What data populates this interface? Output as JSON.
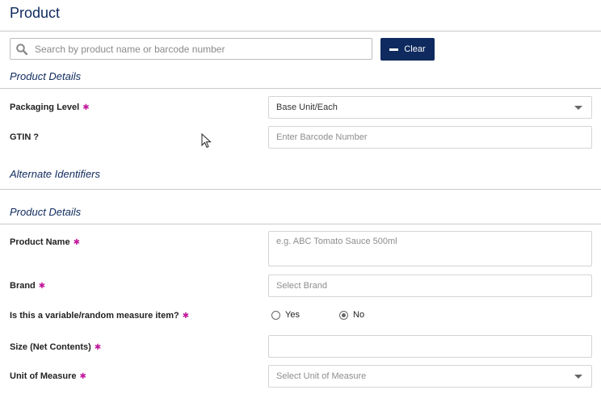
{
  "page": {
    "title": "Product"
  },
  "search": {
    "placeholder": "Search by product name or barcode number",
    "icon": "search-icon",
    "clear_label": "Clear",
    "clear_icon": "minus-icon"
  },
  "sections": {
    "product_details_1": "Product Details",
    "alternate_identifiers": "Alternate Identifiers",
    "product_details_2": "Product Details"
  },
  "fields": {
    "packaging_level": {
      "label": "Packaging Level",
      "value": "Base Unit/Each",
      "required": true
    },
    "gtin": {
      "label": "GTIN",
      "help": "?",
      "placeholder": "Enter Barcode Number"
    },
    "product_name": {
      "label": "Product Name",
      "placeholder": "e.g. ABC Tomato Sauce 500ml",
      "required": true
    },
    "brand": {
      "label": "Brand",
      "placeholder": "Select Brand",
      "required": true
    },
    "variable_measure": {
      "label": "Is this a variable/random measure item?",
      "required": true,
      "options": [
        {
          "label": "Yes",
          "selected": false
        },
        {
          "label": "No",
          "selected": true
        }
      ]
    },
    "size": {
      "label": "Size (Net Contents)",
      "value": "",
      "required": true
    },
    "unit_of_measure": {
      "label": "Unit of Measure",
      "placeholder": "Select Unit of Measure",
      "required": true
    }
  },
  "required_marker": "✱",
  "colors": {
    "brand_navy": "#0f2a5e",
    "required": "#c2189b",
    "divider": "#c9c9c9"
  }
}
